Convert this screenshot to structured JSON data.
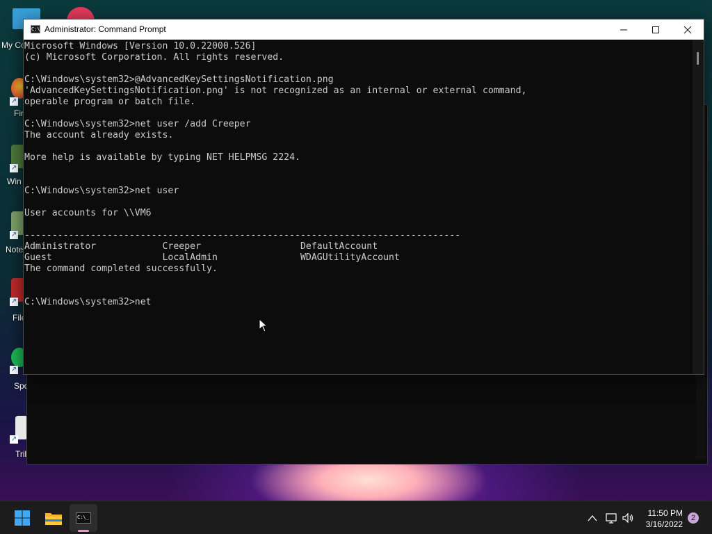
{
  "desktop": {
    "icons": [
      {
        "label": "My Co",
        "color": "#3aa0d8"
      },
      {
        "label": "Fir",
        "color": "#e8672b"
      },
      {
        "label": "Win",
        "color": "#4e7a3a"
      },
      {
        "label": "Note",
        "color": "#7fa36b"
      },
      {
        "label": "File",
        "color": "#c02a2a"
      },
      {
        "label": "Spo",
        "color": "#1db954"
      },
      {
        "label": "Trill",
        "color": "#e8e8e8"
      }
    ]
  },
  "window": {
    "title": "Administrator: Command Prompt",
    "icon_text": "C:\\",
    "minimize_glyph": "—",
    "maximize_glyph": "☐",
    "close_glyph": "✕"
  },
  "console": {
    "lines": [
      "Microsoft Windows [Version 10.0.22000.526]",
      "(c) Microsoft Corporation. All rights reserved.",
      "",
      "C:\\Windows\\system32>@AdvancedKeySettingsNotification.png",
      "'AdvancedKeySettingsNotification.png' is not recognized as an internal or external command,",
      "operable program or batch file.",
      "",
      "C:\\Windows\\system32>net user /add Creeper",
      "The account already exists.",
      "",
      "More help is available by typing NET HELPMSG 2224.",
      "",
      "",
      "C:\\Windows\\system32>net user",
      "",
      "User accounts for \\\\VM6",
      "",
      "-------------------------------------------------------------------------------",
      "Administrator            Creeper                  DefaultAccount",
      "Guest                    LocalAdmin               WDAGUtilityAccount",
      "The command completed successfully.",
      "",
      "",
      "C:\\Windows\\system32>net"
    ]
  },
  "taskbar": {
    "start_icon": "windows-start-icon",
    "pinned": [
      "file-explorer-icon",
      "command-prompt-icon"
    ],
    "terminal_label": "C:\\_",
    "tray": {
      "chevron": "^",
      "time": "11:50 PM",
      "date": "3/16/2022",
      "notifications": "2"
    }
  },
  "colors": {
    "console_bg": "#0c0c0c",
    "console_text": "#cccccc",
    "taskbar_bg": "#1c1c1c",
    "titlebar_bg": "#ffffff"
  }
}
